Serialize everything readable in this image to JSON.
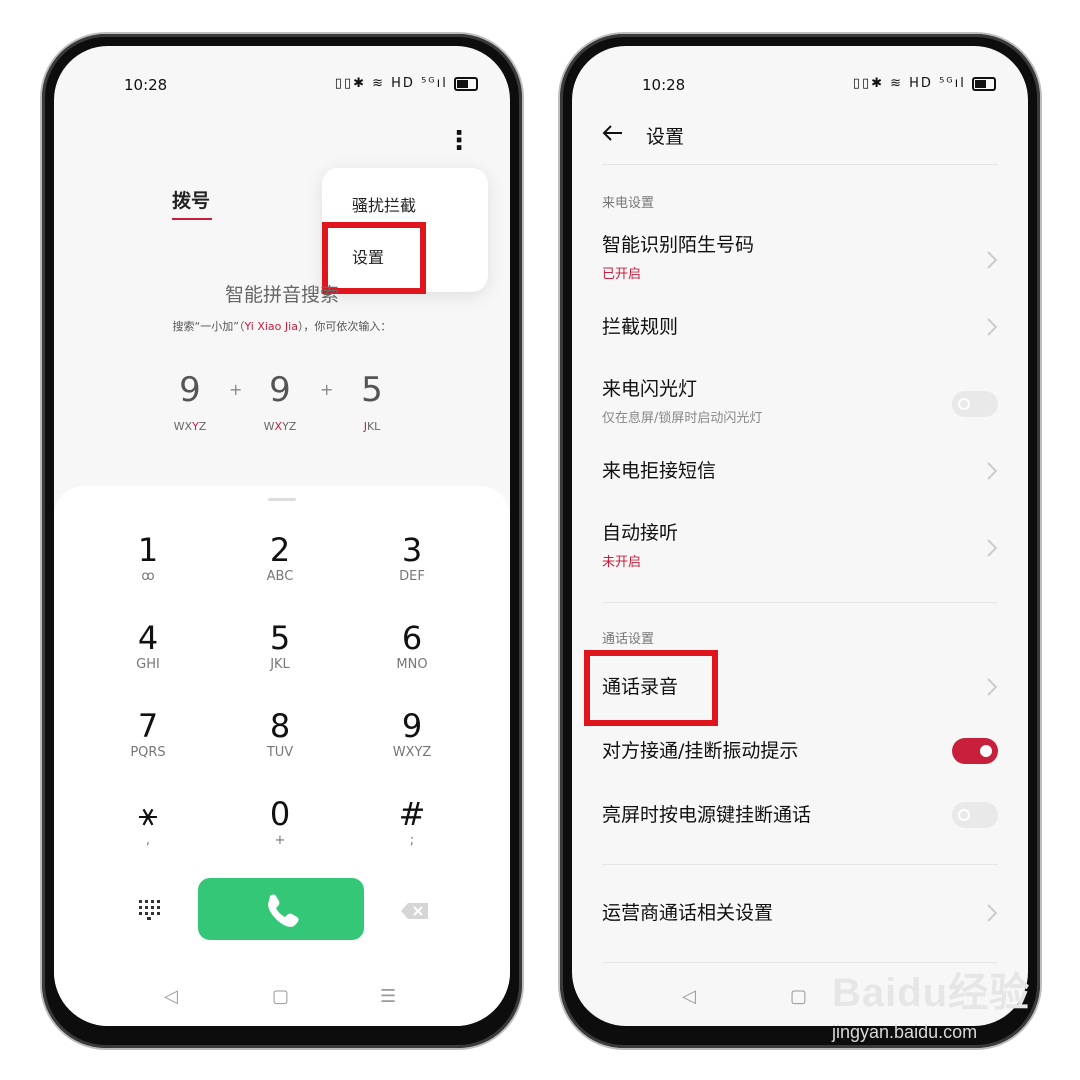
{
  "left_phone": {
    "status": {
      "time": "10:28",
      "icons": "▯▯✱ ≋ HD ⁵ᴳıl"
    },
    "menu_icon": "more-vertical-icon",
    "tab_label": "拨号",
    "popup": {
      "items": [
        "骚扰拦截",
        "设置"
      ]
    },
    "search": {
      "title": "智能拼音搜索",
      "hint_prefix": "搜索“一小加”（",
      "hint_name": "Yi Xiao Jia",
      "hint_suffix": "），你可依次输入："
    },
    "example_digits": [
      {
        "digit": "9",
        "letters_a": "WX",
        "letters_hl": "Y",
        "letters_b": "Z"
      },
      {
        "digit": "9",
        "letters_a": "W",
        "letters_hl": "X",
        "letters_b": "YZ"
      },
      {
        "digit": "5",
        "letters_a": "",
        "letters_hl": "J",
        "letters_b": "KL"
      }
    ],
    "plus_sign": "+",
    "keys": [
      {
        "n": "1",
        "l": "ꝏ"
      },
      {
        "n": "2",
        "l": "ABC"
      },
      {
        "n": "3",
        "l": "DEF"
      },
      {
        "n": "4",
        "l": "GHI"
      },
      {
        "n": "5",
        "l": "JKL"
      },
      {
        "n": "6",
        "l": "MNO"
      },
      {
        "n": "7",
        "l": "PQRS"
      },
      {
        "n": "8",
        "l": "TUV"
      },
      {
        "n": "9",
        "l": "WXYZ"
      },
      {
        "n": "⚹",
        "l": ","
      },
      {
        "n": "0",
        "l": "+"
      },
      {
        "n": "#",
        "l": ";"
      }
    ],
    "call_color": "#34c777",
    "nav": {
      "back": "◁",
      "home": "▢",
      "menu": "☰"
    }
  },
  "right_phone": {
    "status": {
      "time": "10:28",
      "icons": "▯▯✱ ≋ HD ⁵ᴳıl"
    },
    "header_title": "设置",
    "section_incoming": "来电设置",
    "rows_incoming": [
      {
        "title": "智能识别陌生号码",
        "sub": "已开启"
      },
      {
        "title": "拦截规则"
      },
      {
        "title": "来电闪光灯",
        "sub": "仅在息屏/锁屏时启动闪光灯",
        "toggle": false
      },
      {
        "title": "来电拒接短信"
      },
      {
        "title": "自动接听",
        "sub": "未开启"
      }
    ],
    "section_call": "通话设置",
    "rows_call": [
      {
        "title": "通话录音"
      },
      {
        "title": "对方接通/挂断振动提示",
        "toggle": true
      },
      {
        "title": "亮屏时按电源键挂断通话",
        "toggle": false
      }
    ],
    "row_carrier": {
      "title": "运营商通话相关设置"
    },
    "nav": {
      "back": "◁",
      "home": "▢"
    }
  },
  "watermark": {
    "top": "Baidu经验",
    "bottom": "jingyan.baidu.com"
  },
  "accent_color": "#c8203c",
  "highlight_box_color": "#e0161e"
}
